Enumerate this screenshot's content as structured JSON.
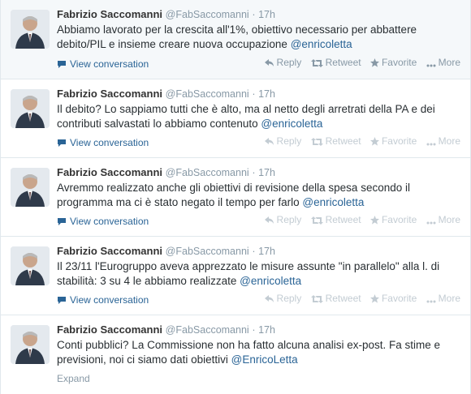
{
  "tweets": [
    {
      "fullname": "Fabrizio Saccomanni",
      "username": "@FabSaccomanni",
      "time": "17h",
      "text": "Abbiamo lavorato per la crescita all'1%, obiettivo necessario per abbattere debito/PIL e insieme creare nuova occupazione ",
      "mention": "@enricoletta",
      "view_conversation": "View conversation",
      "actions": {
        "reply": "Reply",
        "retweet": "Retweet",
        "favorite": "Favorite",
        "more": "More"
      }
    },
    {
      "fullname": "Fabrizio Saccomanni",
      "username": "@FabSaccomanni",
      "time": "17h",
      "text": "Il debito? Lo sappiamo tutti che è alto, ma al netto degli arretrati della PA e dei contributi salvastati lo abbiamo contenuto ",
      "mention": "@enricoletta",
      "view_conversation": "View conversation",
      "actions": {
        "reply": "Reply",
        "retweet": "Retweet",
        "favorite": "Favorite",
        "more": "More"
      }
    },
    {
      "fullname": "Fabrizio Saccomanni",
      "username": "@FabSaccomanni",
      "time": "17h",
      "text": "Avremmo realizzato anche gli obiettivi di revisione della spesa secondo il programma ma ci è stato negato il tempo per farlo ",
      "mention": "@enricoletta",
      "view_conversation": "View conversation",
      "actions": {
        "reply": "Reply",
        "retweet": "Retweet",
        "favorite": "Favorite",
        "more": "More"
      }
    },
    {
      "fullname": "Fabrizio Saccomanni",
      "username": "@FabSaccomanni",
      "time": "17h",
      "text": "Il 23/11 l'Eurogruppo aveva apprezzato le misure assunte \"in parallelo\" alla l. di stabilità: 3 su 4 le abbiamo realizzate ",
      "mention": "@enricoletta",
      "view_conversation": "View conversation",
      "actions": {
        "reply": "Reply",
        "retweet": "Retweet",
        "favorite": "Favorite",
        "more": "More"
      }
    },
    {
      "fullname": "Fabrizio Saccomanni",
      "username": "@FabSaccomanni",
      "time": "17h",
      "text": "Conti pubblici? La Commissione non ha fatto alcuna analisi ex-post. Fa stime e previsioni, noi ci siamo dati obiettivi ",
      "mention": "@EnricoLetta",
      "expand": "Expand"
    }
  ],
  "colors": {
    "link": "#2a6496",
    "muted": "#8899a6",
    "first_bg": "#f5f8fa"
  },
  "icons": {
    "conversation": "speech-bubble-icon",
    "reply": "reply-arrow-icon",
    "retweet": "retweet-icon",
    "favorite": "star-icon",
    "more": "dots-icon"
  }
}
